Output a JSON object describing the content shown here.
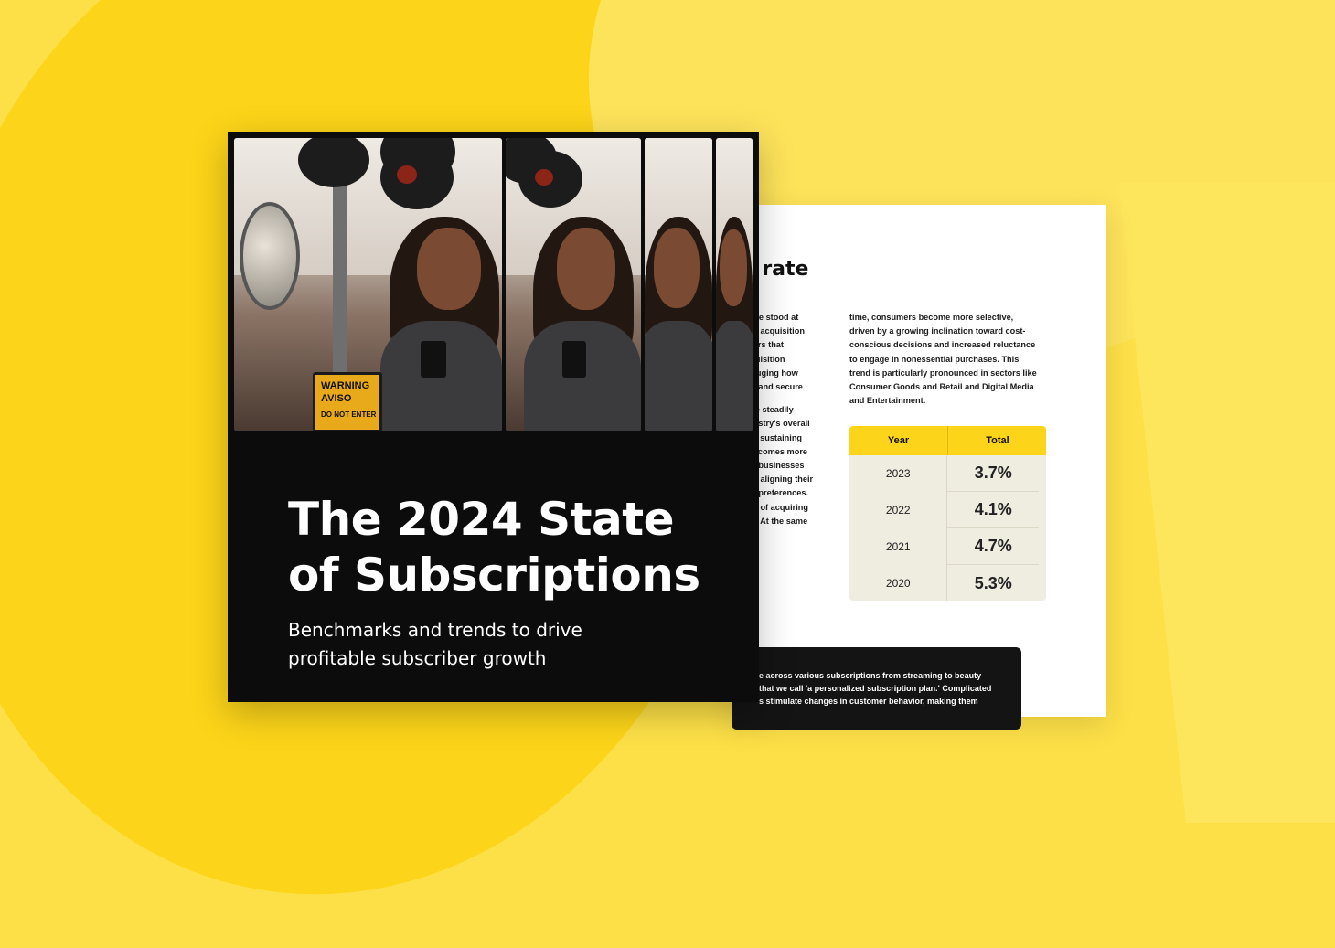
{
  "background": {
    "color": "#fde047",
    "accent": "#fcd419"
  },
  "back_page": {
    "heading": "n rate",
    "left_column": [
      "n rate stood at\n, the acquisition\nomers that\nacquisition\nr gauging how\nract and secure",
      "have steadily\nindustry's overall\nrow, sustaining\nh becomes more\ntion businesses\nn by aligning their\nmer preferences.\ncost of acquiring\nrise. At the same"
    ],
    "right_column": "time, consumers become more selective,\ndriven by a growing inclination toward cost-\nconscious decisions and increased reluctance\nto engage in nonessential purchases. This\ntrend is particularly pronounced in sectors like\nConsumer Goods and Retail and Digital Media\nand Entertainment.",
    "table": {
      "headers": [
        "Year",
        "Total"
      ],
      "rows": [
        {
          "year": "2023",
          "total": "3.7%"
        },
        {
          "year": "2022",
          "total": "4.1%"
        },
        {
          "year": "2021",
          "total": "4.7%"
        },
        {
          "year": "2020",
          "total": "5.3%"
        }
      ]
    },
    "quote_box": "e across various subscriptions from streaming to beauty\n that we call 'a personalized subscription plan.' Complicated\ns stimulate changes in customer behavior, making them"
  },
  "cover": {
    "title": "The 2024 State\nof Subscriptions",
    "subtitle": "Benchmarks and trends to drive\nprofitable subscriber growth",
    "photo": {
      "sign_line1": "WARNING",
      "sign_line2": "AVISO",
      "sign_line3": "DO NOT ENTER"
    }
  }
}
